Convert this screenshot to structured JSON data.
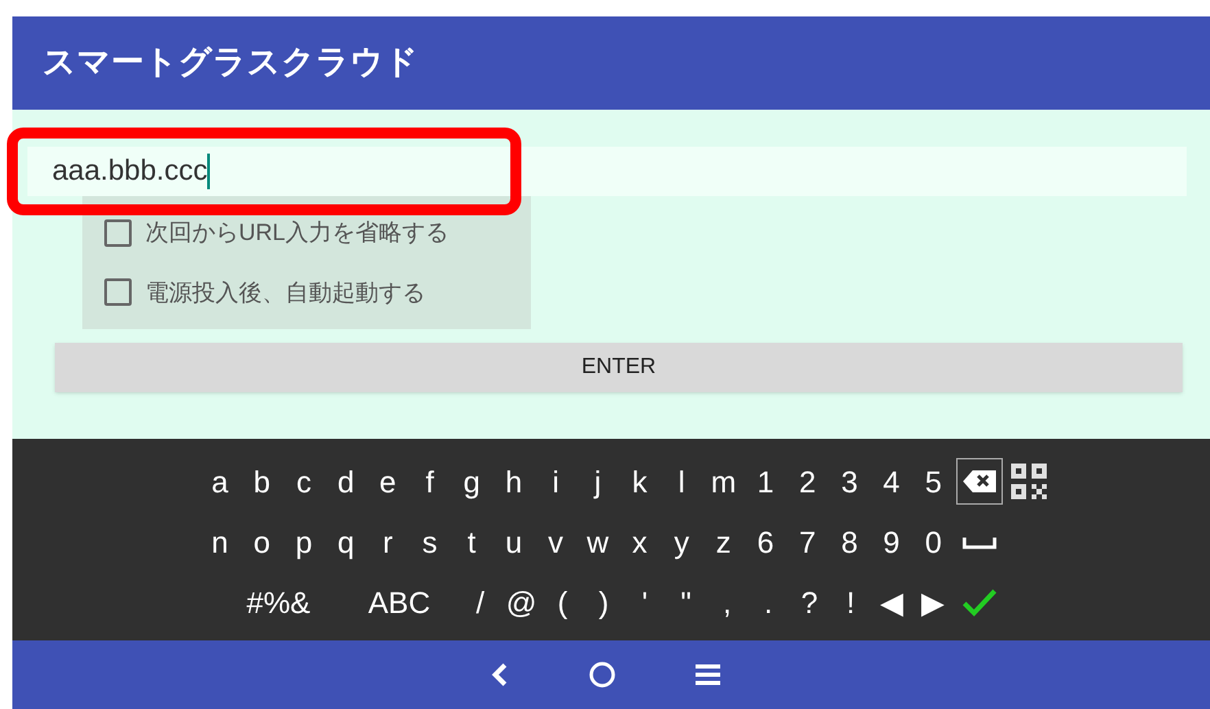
{
  "app_bar": {
    "title": "スマートグラスクラウド"
  },
  "url_field": {
    "value": "aaa.bbb.ccc",
    "highlighted": true
  },
  "options": [
    {
      "label": "次回からURL入力を省略する",
      "checked": false
    },
    {
      "label": "電源投入後、自動起動する",
      "checked": false
    }
  ],
  "enter_button": {
    "label": "ENTER"
  },
  "keyboard": {
    "letter_rows": [
      [
        {
          "kind": "key",
          "label": "a"
        },
        {
          "kind": "key",
          "label": "b"
        },
        {
          "kind": "key",
          "label": "c"
        },
        {
          "kind": "key",
          "label": "d"
        },
        {
          "kind": "key",
          "label": "e"
        },
        {
          "kind": "key",
          "label": "f"
        },
        {
          "kind": "key",
          "label": "g"
        },
        {
          "kind": "key",
          "label": "h"
        },
        {
          "kind": "key",
          "label": "i"
        },
        {
          "kind": "key",
          "label": "j"
        },
        {
          "kind": "key",
          "label": "k"
        },
        {
          "kind": "key",
          "label": "l"
        },
        {
          "kind": "key",
          "label": "m"
        },
        {
          "kind": "key",
          "label": "1"
        },
        {
          "kind": "key",
          "label": "2"
        },
        {
          "kind": "key",
          "label": "3"
        },
        {
          "kind": "key",
          "label": "4"
        },
        {
          "kind": "key",
          "label": "5"
        },
        {
          "kind": "backspace"
        },
        {
          "kind": "qr"
        }
      ],
      [
        {
          "kind": "key",
          "label": "n"
        },
        {
          "kind": "key",
          "label": "o"
        },
        {
          "kind": "key",
          "label": "p"
        },
        {
          "kind": "key",
          "label": "q"
        },
        {
          "kind": "key",
          "label": "r"
        },
        {
          "kind": "key",
          "label": "s"
        },
        {
          "kind": "key",
          "label": "t"
        },
        {
          "kind": "key",
          "label": "u"
        },
        {
          "kind": "key",
          "label": "v"
        },
        {
          "kind": "key",
          "label": "w"
        },
        {
          "kind": "key",
          "label": "x"
        },
        {
          "kind": "key",
          "label": "y"
        },
        {
          "kind": "key",
          "label": "z"
        },
        {
          "kind": "key",
          "label": "6"
        },
        {
          "kind": "key",
          "label": "7"
        },
        {
          "kind": "key",
          "label": "8"
        },
        {
          "kind": "key",
          "label": "9"
        },
        {
          "kind": "key",
          "label": "0"
        },
        {
          "kind": "space"
        }
      ]
    ],
    "symbol_row": [
      {
        "kind": "wide",
        "label": "#%&"
      },
      {
        "kind": "wide",
        "label": "ABC"
      },
      {
        "kind": "key",
        "label": "/"
      },
      {
        "kind": "key",
        "label": "@"
      },
      {
        "kind": "key",
        "label": "("
      },
      {
        "kind": "key",
        "label": ")"
      },
      {
        "kind": "key",
        "label": "'"
      },
      {
        "kind": "key",
        "label": "\""
      },
      {
        "kind": "key",
        "label": ","
      },
      {
        "kind": "key",
        "label": "."
      },
      {
        "kind": "key",
        "label": "?"
      },
      {
        "kind": "key",
        "label": "!"
      },
      {
        "kind": "key",
        "label": "◀"
      },
      {
        "kind": "key",
        "label": "▶"
      },
      {
        "kind": "done"
      }
    ]
  }
}
